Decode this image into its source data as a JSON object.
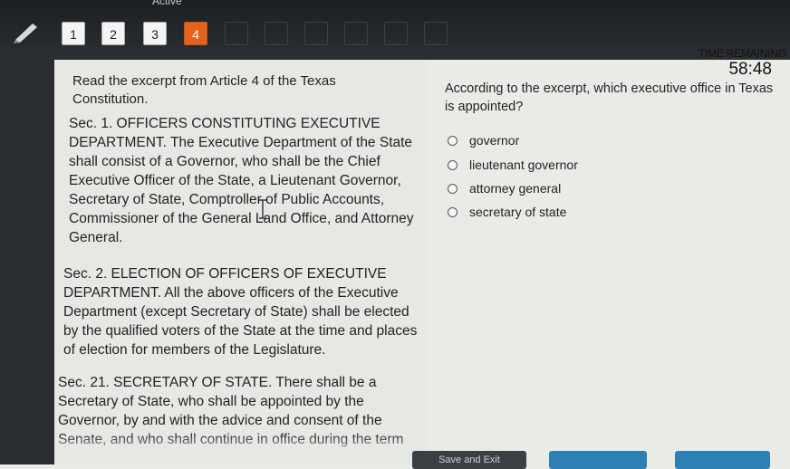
{
  "header": {
    "status_text": "Active",
    "question_numbers": [
      "1",
      "2",
      "3",
      "4"
    ],
    "active_question": "4"
  },
  "timer": {
    "label": "TIME REMAINING",
    "value": "58:48"
  },
  "passage": {
    "intro": "Read the excerpt from Article 4 of the Texas Constitution.",
    "sections": [
      "Sec. 1. OFFICERS CONSTITUTING EXECUTIVE DEPARTMENT. The Executive Department of the State shall consist of a Governor, who shall be the Chief Executive Officer of the State, a Lieutenant Governor, Secretary of State, Comptroller of Public Accounts, Commissioner of the General Land Office, and Attorney General.",
      "Sec. 2. ELECTION OF OFFICERS OF EXECUTIVE DEPARTMENT. All the above officers of the Executive Department (except Secretary of State) shall be elected by the qualified voters of the State at the time and places of election for members of the Legislature.",
      "Sec. 21. SECRETARY OF STATE. There shall be a Secretary of State, who shall be appointed by the Governor, by and with the advice and consent of the Senate, and who shall continue in office during the term"
    ]
  },
  "question": {
    "prompt": "According to the excerpt, which executive office in Texas is appointed?",
    "choices": [
      "governor",
      "lieutenant governor",
      "attorney general",
      "secretary of state"
    ]
  },
  "footer": {
    "save_exit_label": "Save and Exit"
  },
  "colors": {
    "active_question": "#e2621e",
    "topbar": "#23272a",
    "panel": "#e9ebe7"
  }
}
